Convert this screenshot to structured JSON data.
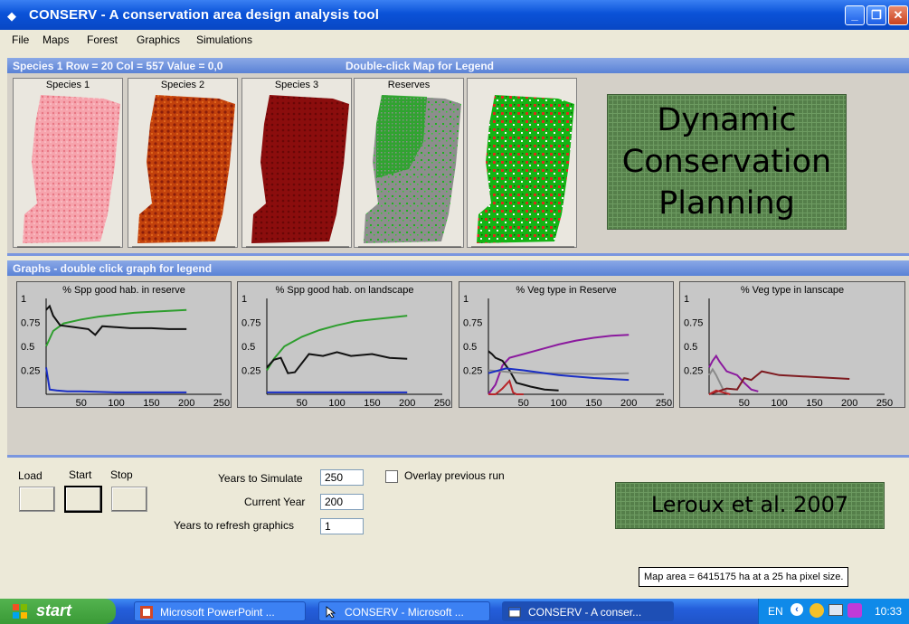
{
  "window": {
    "title": "CONSERV - A conservation area design analysis tool"
  },
  "menu": [
    "File",
    "Maps",
    "Forest",
    "Graphics",
    "Simulations"
  ],
  "maps_panel": {
    "status": "Species 1 Row = 20 Col = 557 Value = 0,0",
    "hint": "Double-click Map for Legend",
    "maps": [
      "Species 1",
      "Species 2",
      "Species 3",
      "Reserves",
      ""
    ]
  },
  "overlay_title": [
    "Dynamic",
    "Conservation",
    "Planning"
  ],
  "overlay_citation": "Leroux et al. 2007",
  "graphs_panel": {
    "header": "Graphs - double click graph for legend",
    "graphs": [
      {
        "title": "% Spp good hab. in reserve"
      },
      {
        "title": "% Spp good hab. on landscape"
      },
      {
        "title": "% Veg type in Reserve"
      },
      {
        "title": "% Veg type in lanscape"
      }
    ],
    "y_ticks": [
      "1",
      "0.75",
      "0.5",
      "0.25"
    ],
    "x_ticks": [
      "50",
      "100",
      "150",
      "200",
      "250"
    ]
  },
  "controls": {
    "load": "Load",
    "start": "Start",
    "stop": "Stop",
    "years_to_simulate_label": "Years to Simulate",
    "years_to_simulate": "250",
    "current_year_label": "Current Year",
    "current_year": "200",
    "refresh_label": "Years to refresh  graphics",
    "refresh": "1",
    "overlay_label": "Overlay previous run"
  },
  "map_area_status": "Map area = 6415175 ha at a 25 ha pixel size.",
  "taskbar": {
    "start": "start",
    "tasks": [
      "Microsoft PowerPoint ...",
      "CONSERV - Microsoft ...",
      "CONSERV - A conser..."
    ],
    "lang": "EN",
    "clock": "10:33"
  },
  "chart_data": [
    {
      "type": "line",
      "title": "% Spp good hab. in reserve",
      "xlim": [
        0,
        250
      ],
      "ylim": [
        0,
        1
      ],
      "series": [
        {
          "color": "#2e9e2e",
          "x": [
            0,
            10,
            25,
            50,
            75,
            100,
            125,
            150,
            175,
            200
          ],
          "y": [
            0.5,
            0.66,
            0.74,
            0.78,
            0.81,
            0.83,
            0.85,
            0.86,
            0.87,
            0.88
          ]
        },
        {
          "color": "#111111",
          "x": [
            0,
            5,
            10,
            20,
            40,
            60,
            70,
            80,
            100,
            120,
            150,
            175,
            200
          ],
          "y": [
            0.88,
            0.92,
            0.82,
            0.72,
            0.7,
            0.68,
            0.62,
            0.71,
            0.7,
            0.69,
            0.69,
            0.68,
            0.68
          ]
        },
        {
          "color": "#1a2ec4",
          "x": [
            0,
            5,
            15,
            30,
            50,
            100,
            150,
            200
          ],
          "y": [
            0.28,
            0.05,
            0.04,
            0.03,
            0.03,
            0.02,
            0.02,
            0.02
          ]
        }
      ]
    },
    {
      "type": "line",
      "title": "% Spp good hab. on landscape",
      "xlim": [
        0,
        250
      ],
      "ylim": [
        0,
        1
      ],
      "series": [
        {
          "color": "#2e9e2e",
          "x": [
            0,
            10,
            25,
            50,
            75,
            100,
            125,
            150,
            175,
            200
          ],
          "y": [
            0.25,
            0.37,
            0.5,
            0.6,
            0.67,
            0.72,
            0.76,
            0.78,
            0.8,
            0.82
          ]
        },
        {
          "color": "#111111",
          "x": [
            0,
            10,
            20,
            30,
            40,
            60,
            80,
            100,
            120,
            150,
            175,
            200
          ],
          "y": [
            0.28,
            0.36,
            0.38,
            0.22,
            0.23,
            0.42,
            0.4,
            0.44,
            0.4,
            0.42,
            0.38,
            0.37
          ]
        },
        {
          "color": "#1a2ec4",
          "x": [
            0,
            50,
            100,
            150,
            200
          ],
          "y": [
            0.02,
            0.02,
            0.02,
            0.02,
            0.02
          ]
        }
      ]
    },
    {
      "type": "line",
      "title": "% Veg type in Reserve",
      "xlim": [
        0,
        250
      ],
      "ylim": [
        0,
        1
      ],
      "series": [
        {
          "color": "#8b1a9e",
          "x": [
            0,
            10,
            20,
            30,
            50,
            75,
            100,
            125,
            150,
            175,
            200
          ],
          "y": [
            0.0,
            0.1,
            0.3,
            0.38,
            0.42,
            0.47,
            0.52,
            0.56,
            0.59,
            0.61,
            0.62
          ]
        },
        {
          "color": "#111111",
          "x": [
            0,
            5,
            10,
            20,
            30,
            40,
            50,
            60,
            80,
            100
          ],
          "y": [
            0.45,
            0.42,
            0.38,
            0.35,
            0.25,
            0.12,
            0.1,
            0.08,
            0.05,
            0.04
          ]
        },
        {
          "color": "#8a8a8a",
          "x": [
            0,
            50,
            100,
            150,
            200
          ],
          "y": [
            0.25,
            0.22,
            0.22,
            0.21,
            0.22
          ]
        },
        {
          "color": "#1a2ec4",
          "x": [
            0,
            25,
            50,
            100,
            150,
            200
          ],
          "y": [
            0.22,
            0.27,
            0.25,
            0.2,
            0.17,
            0.15
          ]
        },
        {
          "color": "#b8262a",
          "x": [
            0,
            10,
            20,
            30,
            35,
            40,
            50
          ],
          "y": [
            0.0,
            0.0,
            0.06,
            0.14,
            0.02,
            0.0,
            0.0
          ]
        }
      ]
    },
    {
      "type": "line",
      "title": "% Veg type in lanscape",
      "xlim": [
        0,
        250
      ],
      "ylim": [
        0,
        1
      ],
      "series": [
        {
          "color": "#8b1a9e",
          "x": [
            0,
            5,
            10,
            15,
            25,
            40,
            50,
            60,
            70
          ],
          "y": [
            0.28,
            0.35,
            0.4,
            0.34,
            0.24,
            0.2,
            0.12,
            0.05,
            0.03
          ]
        },
        {
          "color": "#8a8a8a",
          "x": [
            0,
            5,
            10,
            20,
            25
          ],
          "y": [
            0.2,
            0.26,
            0.2,
            0.05,
            0.03
          ]
        },
        {
          "color": "#7e1b20",
          "x": [
            0,
            25,
            40,
            50,
            60,
            75,
            100,
            150,
            200
          ],
          "y": [
            0.0,
            0.06,
            0.05,
            0.17,
            0.15,
            0.24,
            0.2,
            0.18,
            0.16
          ]
        },
        {
          "color": "#b8262a",
          "x": [
            0,
            10,
            20,
            30
          ],
          "y": [
            0.0,
            0.04,
            0.02,
            0.0
          ]
        }
      ]
    }
  ]
}
